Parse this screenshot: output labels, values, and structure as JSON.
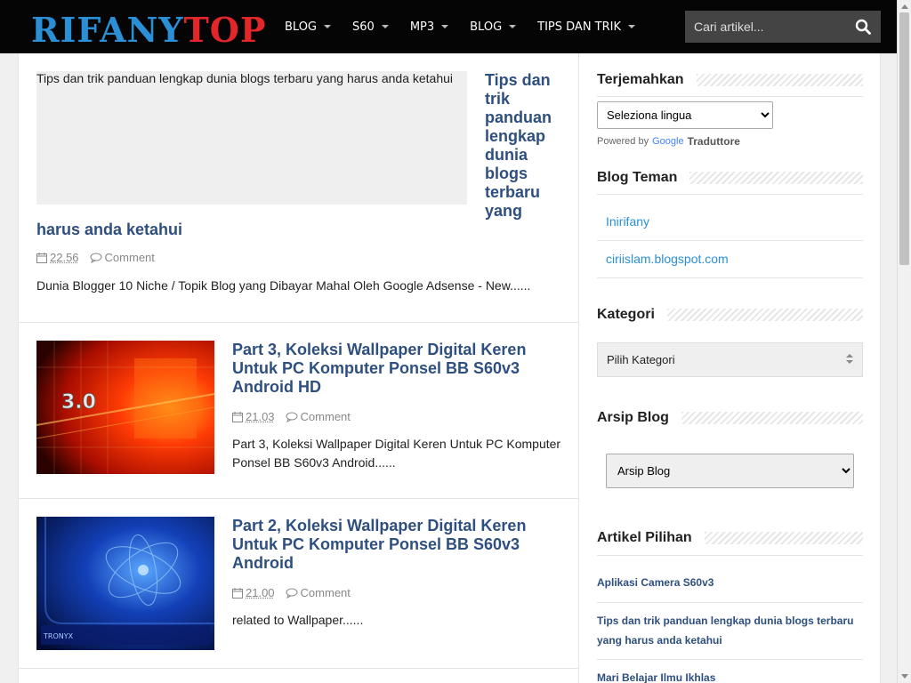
{
  "header": {
    "logo_part1": "RIFANY",
    "logo_part2": "TOP",
    "colors": {
      "logo_blue": "#2b8fd6",
      "logo_red": "#e3262a",
      "header_bg": "#050505"
    },
    "nav": [
      {
        "label": "BLOG"
      },
      {
        "label": "S60"
      },
      {
        "label": "MP3"
      },
      {
        "label": "BLOG"
      },
      {
        "label": "TIPS DAN TRIK"
      }
    ],
    "search_placeholder": "Cari artikel..."
  },
  "posts": [
    {
      "image_alt": "Tips dan trik panduan lengkap dunia blogs terbaru yang harus anda ketahui",
      "title_part1": "Tips dan trik panduan lengkap dunia blogs terbaru yang",
      "title_part2": "harus anda ketahui",
      "time": "22.56",
      "comment": "Comment",
      "excerpt": "Dunia Blogger 10 Niche / Topik Blog yang Dibayar Mahal Oleh Google Adsense - New......"
    },
    {
      "thumb_text": "3.0",
      "title": "Part 3, Koleksi Wallpaper Digital Keren Untuk PC Komputer Ponsel BB S60v3 Android HD",
      "time": "21.03",
      "comment": "Comment",
      "excerpt": "Part 3, Koleksi Wallpaper Digital Keren Untuk PC Komputer Ponsel BB S60v3 Android......"
    },
    {
      "thumb_text": "TRONYX",
      "title": "Part 2, Koleksi Wallpaper Digital Keren Untuk PC Komputer Ponsel BB S60v3 Android",
      "time": "21.00",
      "comment": "Comment",
      "excerpt": "related to Wallpaper......"
    }
  ],
  "sidebar": {
    "translate": {
      "title": "Terjemahkan",
      "select_value": "Seleziona lingua",
      "powered_by": "Powered by",
      "google": "Google",
      "translator": "Traduttore"
    },
    "friends": {
      "title": "Blog Teman",
      "links": [
        "Inirifany",
        "ciriislam.blogspot.com"
      ]
    },
    "categories": {
      "title": "Kategori",
      "select_value": "Pilih Kategori"
    },
    "archive": {
      "title": "Arsip Blog",
      "select_value": "Arsip Blog"
    },
    "picks": {
      "title": "Artikel Pilihan",
      "items": [
        "Aplikasi Camera S60v3",
        "Tips dan trik panduan lengkap dunia blogs terbaru yang harus anda ketahui",
        "Mari Belajar Ilmu Ikhlas"
      ]
    }
  }
}
